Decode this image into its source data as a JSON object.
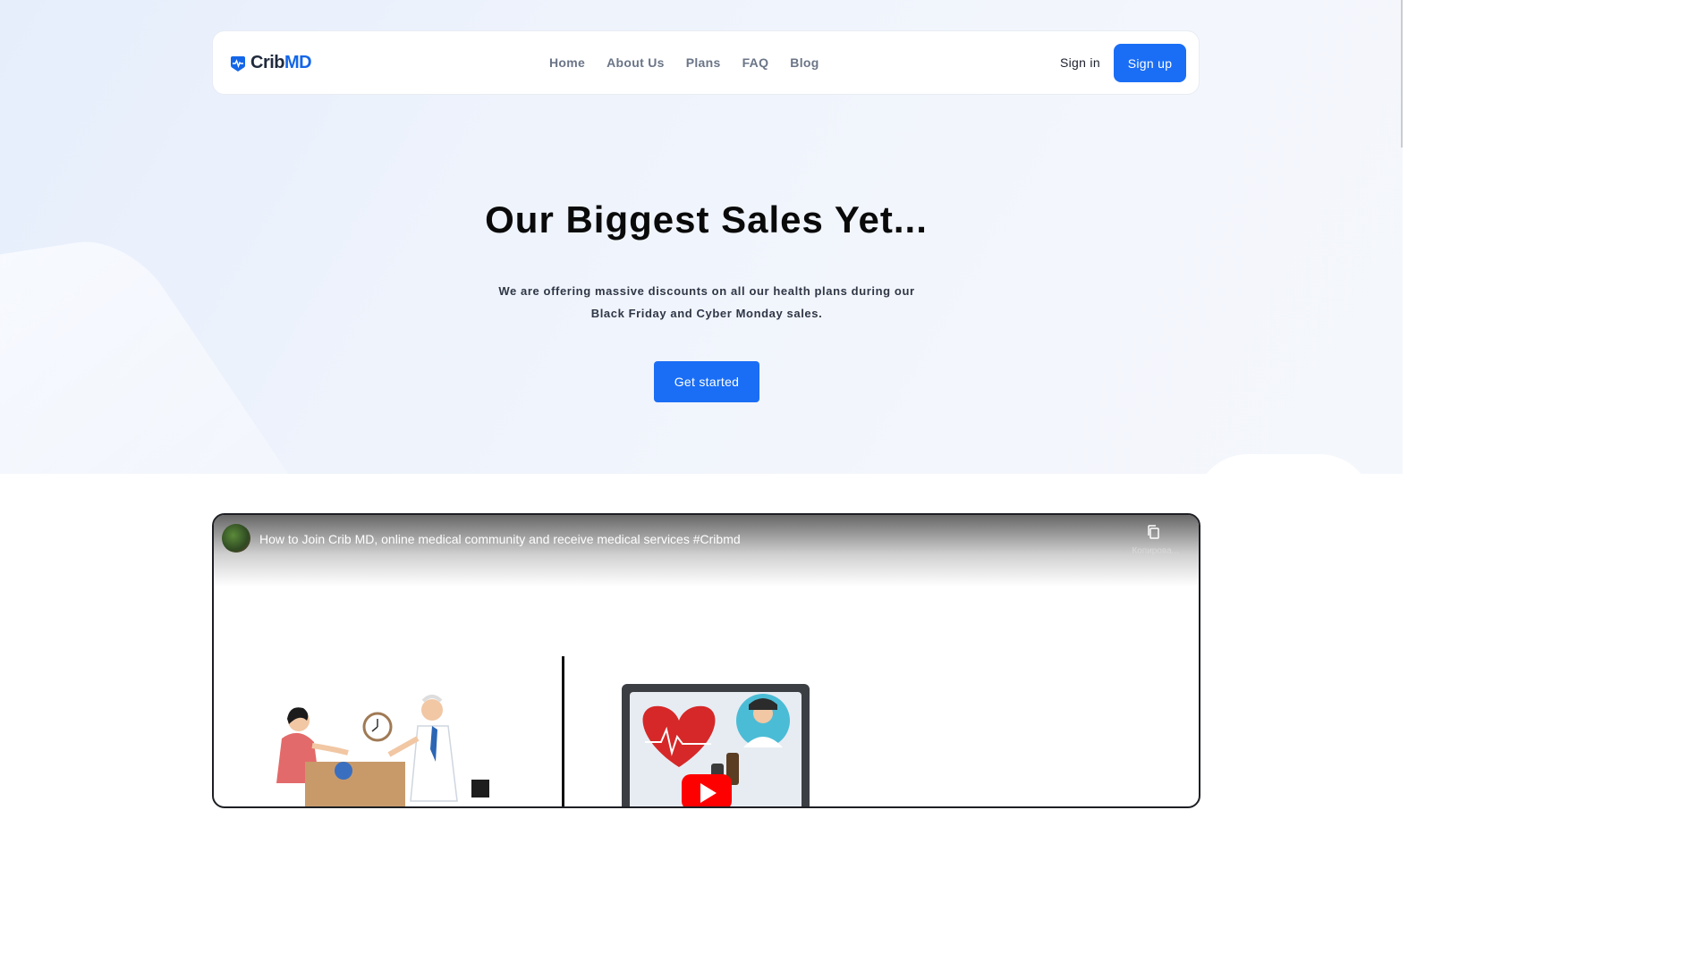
{
  "brand": {
    "name_part1": "Crib",
    "name_part2": "MD",
    "color": "#1466e8"
  },
  "nav": {
    "links": [
      "Home",
      "About Us",
      "Plans",
      "FAQ",
      "Blog"
    ],
    "signin": "Sign in",
    "signup": "Sign up"
  },
  "hero": {
    "title": "Our Biggest Sales Yet...",
    "subtitle_line1": "We are offering massive discounts on all our health plans during our",
    "subtitle_line2": "Black Friday and Cyber Monday sales.",
    "cta": "Get started"
  },
  "video": {
    "title": "How to Join Crib MD, online medical community and receive medical services #Cribmd",
    "copy_label": "Копирова..."
  },
  "colors": {
    "accent": "#1a6ef5",
    "nav_text": "#6b7587",
    "title": "#0a0a0a"
  }
}
